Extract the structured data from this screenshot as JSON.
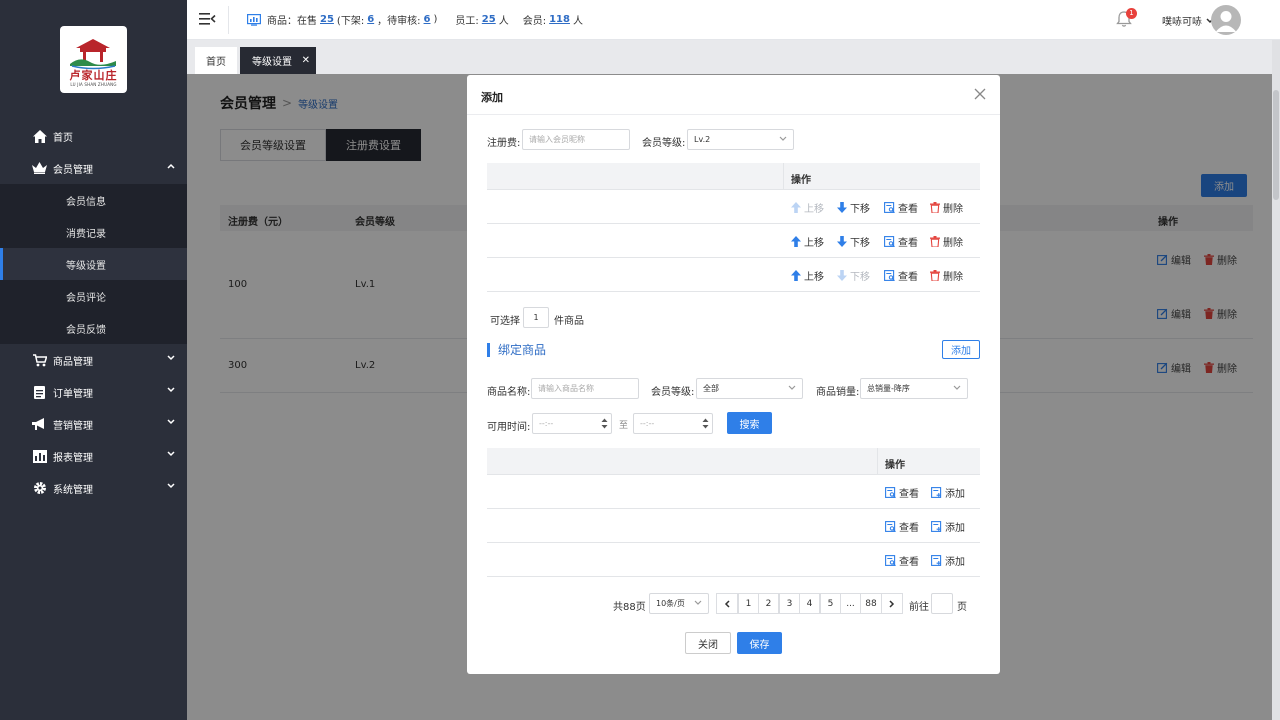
{
  "sidebar": {
    "logo_text": "卢家山庄",
    "logo_subtext": "LU JIA SHAN ZHUANG",
    "menu": [
      {
        "label": "首页",
        "icon": "home-icon"
      },
      {
        "label": "会员管理",
        "icon": "crown-icon",
        "expanded": true
      },
      {
        "label": "商品管理",
        "icon": "cart-icon"
      },
      {
        "label": "订单管理",
        "icon": "clipboard-icon"
      },
      {
        "label": "营销管理",
        "icon": "megaphone-icon"
      },
      {
        "label": "报表管理",
        "icon": "bar-chart-icon"
      },
      {
        "label": "系统管理",
        "icon": "gear-icon"
      }
    ],
    "submenu": [
      "会员信息",
      "消费记录",
      "等级设置",
      "会员评论",
      "会员反馈"
    ],
    "active_sub": "等级设置"
  },
  "topbar": {
    "stats": {
      "goods_label": "商品：在售",
      "on_sale": "25",
      "off_label": "(下架:",
      "off_shelf": "6",
      "pending_label": "，待审核:",
      "pending": "6",
      "close_paren": ")",
      "staff_label": "员工:",
      "staff": "25",
      "staff_unit": "人",
      "member_label": "会员:",
      "members": "118",
      "member_unit": "人"
    },
    "notification_count": "1",
    "username": "噗哧可哧"
  },
  "tabs": {
    "home": "首页",
    "current": "等级设置"
  },
  "page": {
    "breadcrumb_main": "会员管理",
    "breadcrumb_sub": "等级设置",
    "tab1": "会员等级设置",
    "tab2": "注册费设置",
    "add_button": "添加",
    "table": {
      "headers": [
        "注册费（元）",
        "会员等级",
        "操作"
      ],
      "rows": [
        {
          "fee": "100",
          "level": "Lv.1"
        },
        {
          "fee": "300",
          "level": "Lv.2"
        }
      ],
      "edit_label": "编辑",
      "delete_label": "删除"
    }
  },
  "modal": {
    "title": "添加",
    "fee_label": "注册费:",
    "fee_placeholder": "请输入会员昵称",
    "level_label": "会员等级:",
    "level_value": "Lv.2",
    "table_header_action": "操作",
    "actions": {
      "up": "上移",
      "down": "下移",
      "view": "查看",
      "delete": "删除",
      "add": "添加"
    },
    "selectable_label": "可选择",
    "selectable_value": "1",
    "selectable_unit": "件商品",
    "bind_title": "绑定商品",
    "bind_add": "添加",
    "goods_name_label": "商品名称:",
    "goods_name_placeholder": "请输入商品名称",
    "goods_level_label": "会员等级:",
    "goods_level_value": "全部",
    "sales_label": "商品销量:",
    "sales_value": "总销量-降序",
    "time_label": "可用时间:",
    "time_placeholder": "--:--",
    "time_to": "至",
    "search_button": "搜索",
    "pager": {
      "total": "共88页",
      "page_size": "10条/页",
      "pages": [
        "1",
        "2",
        "3",
        "4",
        "5",
        "...",
        "88"
      ],
      "goto_label": "前往",
      "goto_unit": "页"
    },
    "close_button": "关闭",
    "save_button": "保存"
  }
}
